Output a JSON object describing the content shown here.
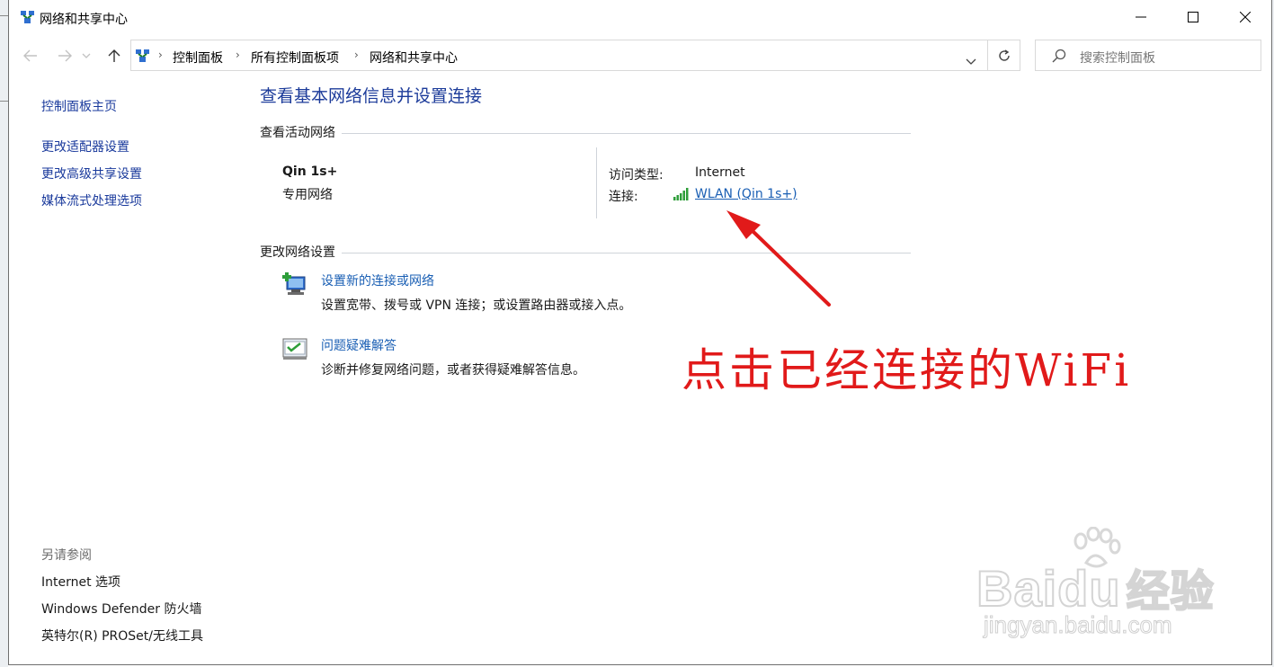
{
  "window": {
    "title": "网络和共享中心"
  },
  "breadcrumb": {
    "items": [
      "控制面板",
      "所有控制面板项",
      "网络和共享中心"
    ]
  },
  "search": {
    "placeholder": "搜索控制面板"
  },
  "sidebar": {
    "home": "控制面板主页",
    "links": [
      "更改适配器设置",
      "更改高级共享设置",
      "媒体流式处理选项"
    ],
    "see_also_heading": "另请参阅",
    "see_also": [
      "Internet 选项",
      "Windows Defender 防火墙",
      "英特尔(R) PROSet/无线工具"
    ]
  },
  "main": {
    "title": "查看基本网络信息并设置连接",
    "active_heading": "查看活动网络",
    "network_name": "Qin 1s+",
    "network_type": "专用网络",
    "access_label": "访问类型:",
    "access_value": "Internet",
    "connection_label": "连接:",
    "connection_link": "WLAN (Qin 1s+)",
    "change_heading": "更改网络设置",
    "tasks": [
      {
        "title": "设置新的连接或网络",
        "desc": "设置宽带、拨号或 VPN 连接；或设置路由器或接入点。",
        "icon": "new-connection-icon"
      },
      {
        "title": "问题疑难解答",
        "desc": "诊断并修复网络问题，或者获得疑难解答信息。",
        "icon": "troubleshoot-icon"
      }
    ]
  },
  "annotation": {
    "text": "点击已经连接的WiFi",
    "color": "#e11a1a"
  },
  "watermark": {
    "brand_a": "Bai",
    "brand_b": "du",
    "brand_c": "经验",
    "url": "jingyan.baidu.com"
  },
  "colors": {
    "link": "#1a5fb4",
    "heading_blue": "#1c3b9a",
    "signal_green": "#2e9e3a"
  }
}
